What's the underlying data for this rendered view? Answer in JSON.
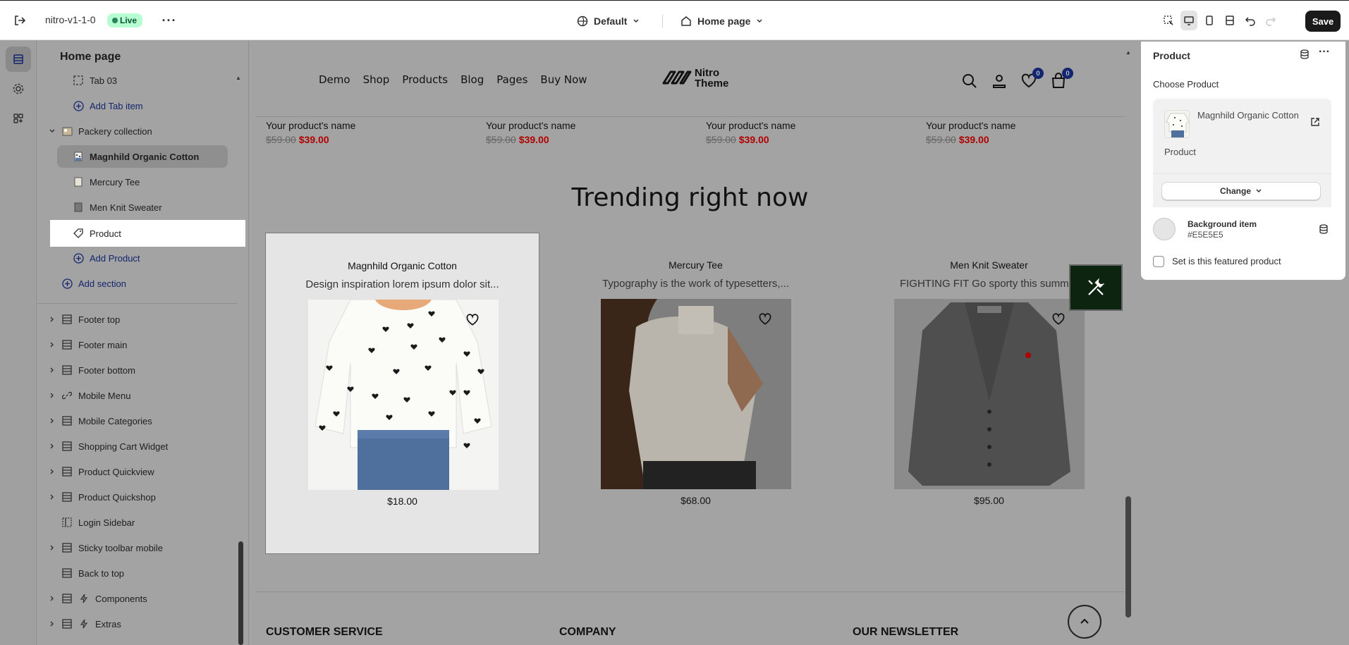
{
  "topbar": {
    "store_name": "nitro-v1-1-0",
    "status": "Live",
    "theme_label": "Default",
    "page_label": "Home page",
    "save_label": "Save"
  },
  "sidebar": {
    "title": "Home page",
    "items": [
      {
        "label": "Tab 03"
      },
      {
        "label": "Add Tab item"
      },
      {
        "label": "Packery collection"
      },
      {
        "label": "Magnhild Organic Cotton"
      },
      {
        "label": "Mercury Tee"
      },
      {
        "label": "Men Knit Sweater"
      },
      {
        "label": "Product"
      },
      {
        "label": "Add Product"
      },
      {
        "label": "Add section"
      },
      {
        "label": "Footer top"
      },
      {
        "label": "Footer main"
      },
      {
        "label": "Footer bottom"
      },
      {
        "label": "Mobile Menu"
      },
      {
        "label": "Mobile Categories"
      },
      {
        "label": "Shopping Cart Widget"
      },
      {
        "label": "Product Quickview"
      },
      {
        "label": "Product Quickshop"
      },
      {
        "label": "Login Sidebar"
      },
      {
        "label": "Sticky toolbar mobile"
      },
      {
        "label": "Back to top"
      },
      {
        "label": "Components"
      },
      {
        "label": "Extras"
      }
    ]
  },
  "preview": {
    "nav": [
      "Demo",
      "Shop",
      "Products",
      "Blog",
      "Pages",
      "Buy Now"
    ],
    "logo_line1": "Nitro",
    "logo_line2": "Theme",
    "wishlist_count": "0",
    "cart_count": "0",
    "top_products": [
      {
        "name": "Your product's name",
        "old_price": "$59.00",
        "price": "$39.00"
      },
      {
        "name": "Your product's name",
        "old_price": "$59.00",
        "price": "$39.00"
      },
      {
        "name": "Your product's name",
        "old_price": "$59.00",
        "price": "$39.00"
      },
      {
        "name": "Your product's name",
        "old_price": "$59.00",
        "price": "$39.00"
      }
    ],
    "section_title": "Trending right now",
    "cards": [
      {
        "name": "Magnhild Organic Cotton",
        "desc": "Design inspiration lorem ipsum dolor sit...",
        "price": "$18.00"
      },
      {
        "name": "Mercury Tee",
        "desc": "Typography is the work of typesetters,...",
        "price": "$68.00"
      },
      {
        "name": "Men Knit Sweater",
        "desc": "FIGHTING FIT Go sporty this summer",
        "price": "$95.00"
      }
    ],
    "footer": [
      "CUSTOMER SERVICE",
      "COMPANY",
      "OUR NEWSLETTER"
    ]
  },
  "panel": {
    "title": "Product",
    "choose_label": "Choose Product",
    "product_name": "Magnhild Organic Cotton",
    "product_type": "Product",
    "change_label": "Change",
    "bg_label": "Background item",
    "bg_value": "#E5E5E5",
    "featured_label": "Set is this featured product",
    "featured_checked": false
  },
  "colors": {
    "accent": "#13256e",
    "sale": "#b00000",
    "live": "#29845a",
    "bg_item": "#E5E5E5"
  }
}
